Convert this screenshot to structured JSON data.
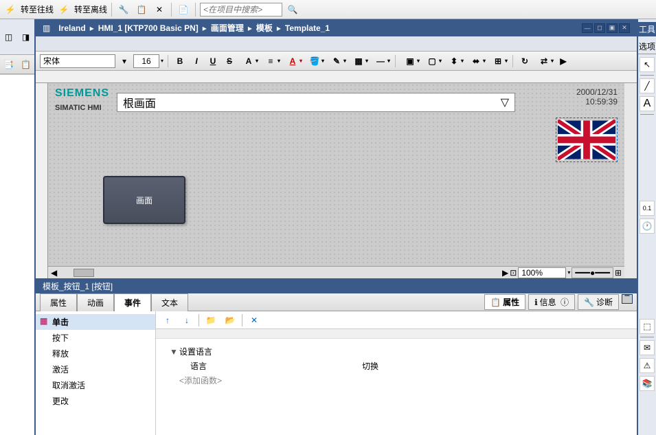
{
  "top": {
    "btn_go_back": "转至往线",
    "btn_go_leave": "转至离线",
    "search_placeholder": "<在项目中搜索>"
  },
  "breadcrumb": [
    "Ireland",
    "HMI_1 [KTP700 Basic PN]",
    "画面管理",
    "模板",
    "Template_1"
  ],
  "format": {
    "font": "宋体",
    "size": "16"
  },
  "canvas": {
    "siemens": "SIEMENS",
    "simatic": "SIMATIC HMI",
    "title_text": "根画面",
    "date": "2000/12/31",
    "time": "10:59:39",
    "button_label": "画面",
    "zoom": "100%"
  },
  "props": {
    "header": "模板_按钮_1 [按钮]",
    "right_tabs": {
      "props": "属性",
      "info": "信息",
      "diag": "诊断"
    },
    "tabs": [
      "属性",
      "动画",
      "事件",
      "文本"
    ],
    "events": [
      "单击",
      "按下",
      "释放",
      "激活",
      "取消激活",
      "更改"
    ],
    "detail": {
      "func": "设置语言",
      "param_label": "语言",
      "param_value": "切换",
      "add_func": "<添加函数>"
    }
  },
  "right_panel": {
    "title1": "工具",
    "title2": "选项"
  }
}
